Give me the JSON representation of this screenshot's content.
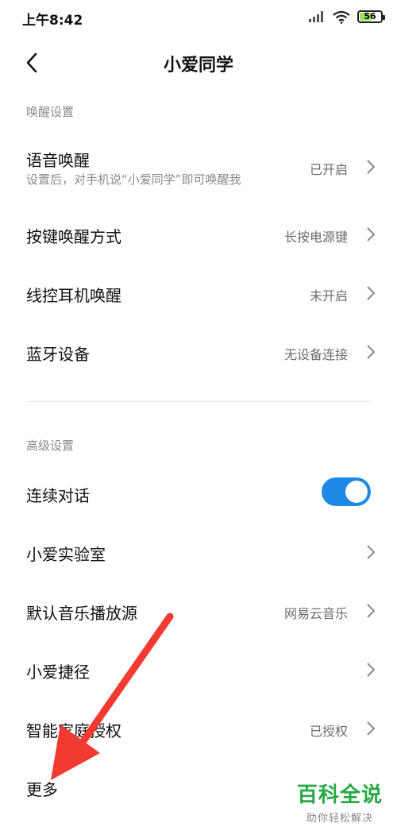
{
  "status_bar": {
    "time": "上午8:42",
    "battery_level": "56",
    "battery_fraction": 0.56,
    "icons": [
      "signal-icon",
      "wifi-icon",
      "battery-icon"
    ]
  },
  "header": {
    "title": "小爱同学",
    "back_icon": "chevron-left-icon"
  },
  "sections": {
    "wake": {
      "header": "唤醒设置",
      "items": [
        {
          "title": "语音唤醒",
          "subtitle": "设置后，对手机说“小爱同学”即可唤醒我",
          "value": "已开启"
        },
        {
          "title": "按键唤醒方式",
          "value": "长按电源键"
        },
        {
          "title": "线控耳机唤醒",
          "value": "未开启"
        },
        {
          "title": "蓝牙设备",
          "value": "无设备连接"
        }
      ]
    },
    "advanced": {
      "header": "高级设置",
      "items": [
        {
          "title": "连续对话",
          "toggle_on": true
        },
        {
          "title": "小爱实验室",
          "value": ""
        },
        {
          "title": "默认音乐播放源",
          "value": "网易云音乐"
        },
        {
          "title": "小爱捷径",
          "value": ""
        },
        {
          "title": "智能家庭授权",
          "value": "已授权"
        },
        {
          "title": "更多",
          "value": ""
        }
      ]
    }
  },
  "colors": {
    "accent": "#1e88e5",
    "annotation_arrow": "#f03a32",
    "watermark": "#28a745"
  },
  "watermark": {
    "title": "百科全说",
    "subtitle": "助你轻松解决"
  }
}
